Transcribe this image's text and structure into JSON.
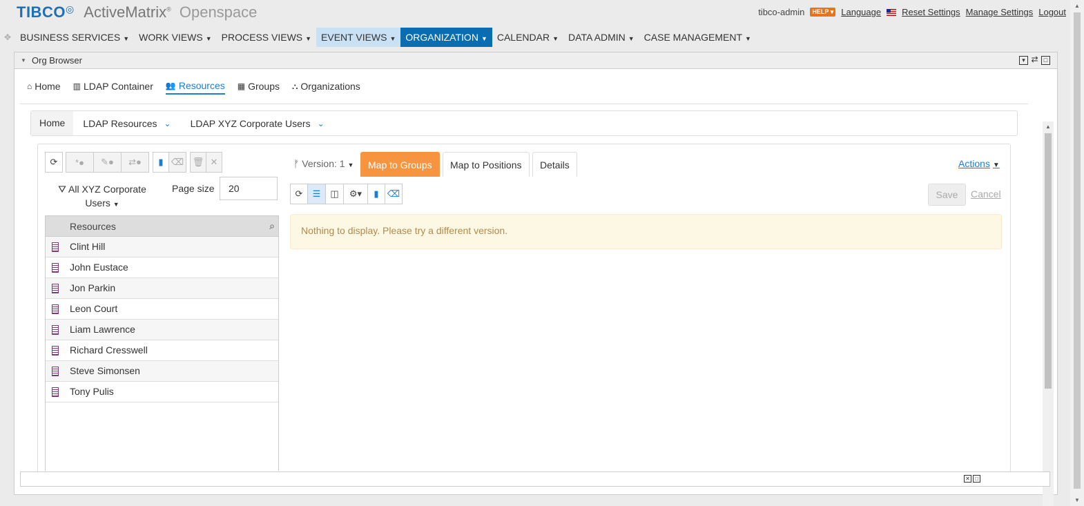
{
  "header": {
    "brand": "TIBCO",
    "product": "ActiveMatrix",
    "product_mark": "®",
    "sub": "Openspace",
    "user": "tibco-admin",
    "help": "HELP",
    "language": "Language",
    "reset": "Reset Settings",
    "manage": "Manage Settings",
    "logout": "Logout"
  },
  "nav": [
    {
      "label": "BUSINESS SERVICES",
      "state": "normal"
    },
    {
      "label": "WORK VIEWS",
      "state": "normal"
    },
    {
      "label": "PROCESS VIEWS",
      "state": "normal"
    },
    {
      "label": "EVENT VIEWS",
      "state": "light"
    },
    {
      "label": "ORGANIZATION",
      "state": "active"
    },
    {
      "label": "CALENDAR",
      "state": "normal"
    },
    {
      "label": "DATA ADMIN",
      "state": "normal"
    },
    {
      "label": "CASE MANAGEMENT",
      "state": "normal"
    }
  ],
  "panel": {
    "title": "Org Browser"
  },
  "tabs": {
    "home": "Home",
    "ldap": "LDAP Container",
    "resources": "Resources",
    "groups": "Groups",
    "organizations": "Organizations"
  },
  "breadcrumb": {
    "home": "Home",
    "seg1": "LDAP Resources",
    "seg2": "LDAP XYZ Corporate Users"
  },
  "left": {
    "filter": "All XYZ Corporate Users",
    "page_size_label": "Page size",
    "page_size_value": "20",
    "column": "Resources",
    "resources": [
      "Clint Hill",
      "John Eustace",
      "Jon Parkin",
      "Leon Court",
      "Liam Lawrence",
      "Richard Cresswell",
      "Steve Simonsen",
      "Tony Pulis"
    ]
  },
  "right": {
    "version": "Version: 1",
    "tab_groups": "Map to Groups",
    "tab_positions": "Map to Positions",
    "tab_details": "Details",
    "actions": "Actions",
    "save": "Save",
    "cancel": "Cancel",
    "message": "Nothing to display. Please try a different version."
  },
  "colors": {
    "accent": "#0a6db1",
    "orange": "#f7943f",
    "link": "#1b7ed6"
  }
}
